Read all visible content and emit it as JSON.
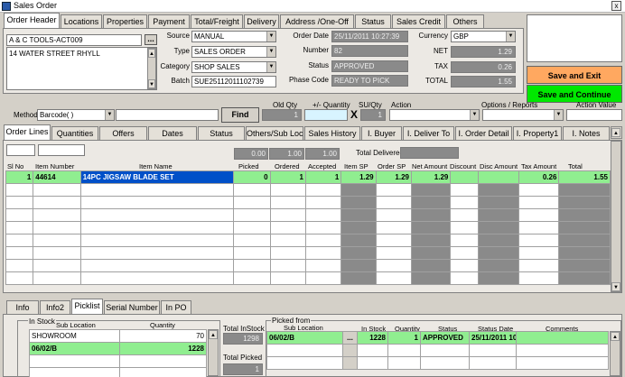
{
  "window": {
    "title": "Sales Order",
    "close": "x"
  },
  "top_tabs": [
    {
      "label": "Order Header",
      "active": true
    },
    {
      "label": "Locations"
    },
    {
      "label": "Properties"
    },
    {
      "label": "Payment"
    },
    {
      "label": "Total/Freight"
    },
    {
      "label": "Delivery"
    },
    {
      "label": "Address /One-Off"
    },
    {
      "label": "Status"
    },
    {
      "label": "Sales Credit"
    },
    {
      "label": "Others"
    }
  ],
  "header": {
    "customer_name": "A & C TOOLS-ACT009",
    "customer_address": "14 WATER STREET  RHYLL",
    "lookup_btn": "...",
    "source_label": "Source",
    "source": "MANUAL",
    "type_label": "Type",
    "type": "SALES ORDER",
    "category_label": "Category",
    "category": "SHOP SALES",
    "batch_label": "Batch",
    "batch": "SUE25112011102739",
    "order_date_label": "Order  Date",
    "order_date": "25/11/2011 10:27:39",
    "number_label": "Number",
    "number": "82",
    "status_label": "Status",
    "status": "APPROVED",
    "phase_label": "Phase Code",
    "phase": "READY TO PICK",
    "currency_label": "Currency",
    "currency": "GBP",
    "net_label": "NET",
    "net": "1.29",
    "tax_label": "TAX",
    "tax": "0.26",
    "total_label": "TOTAL",
    "total": "1.55"
  },
  "actions": {
    "save_exit": "Save and Exit",
    "save_continue": "Save and Continue"
  },
  "method_bar": {
    "method_label": "Method",
    "method": "Barcode( )",
    "find": "Find",
    "old_qty_label": "Old Qty",
    "old_qty": "1",
    "plus_minus_label": "+/- Quantity",
    "su_qty_label": "SU/Qty",
    "su_qty": "1",
    "x": "X",
    "action_label": "Action",
    "options_label": "Options / Reports",
    "action_value_label": "Action Value"
  },
  "line_tabs": [
    {
      "label": "Order Lines",
      "active": true
    },
    {
      "label": "Quantities"
    },
    {
      "label": "Offers"
    },
    {
      "label": "Dates"
    },
    {
      "label": "Status"
    },
    {
      "label": "Others/Sub Loc"
    },
    {
      "label": "Sales History"
    },
    {
      "label": "I. Buyer"
    },
    {
      "label": "I. Deliver To"
    },
    {
      "label": "I. Order Detail"
    },
    {
      "label": "I. Property1"
    },
    {
      "label": "I. Notes"
    }
  ],
  "totals_row": {
    "picked": "0.00",
    "ordered": "1.00",
    "accepted": "1.00",
    "delivered_label": "Total Delivered"
  },
  "lines": {
    "columns": [
      "Sl No",
      "Item Number",
      "Item Name",
      "Picked",
      "Ordered",
      "Accepted",
      "Item SP",
      "Order SP",
      "Net Amount",
      "Discount",
      "Disc Amount",
      "Tax Amount",
      "Total"
    ],
    "rows": [
      [
        "1",
        "44614",
        "14PC JIGSAW BLADE SET",
        "0",
        "1",
        "1",
        "1.29",
        "1.29",
        "1.29",
        "",
        "",
        "0.26",
        "1.55"
      ]
    ]
  },
  "bottom_tabs": [
    {
      "label": "Info"
    },
    {
      "label": "Info2"
    },
    {
      "label": "Picklist",
      "active": true
    },
    {
      "label": "Serial Number"
    },
    {
      "label": "In PO"
    }
  ],
  "instock": {
    "group_label": "In Stock",
    "columns": [
      "Sub Location",
      "Quantity"
    ],
    "rows": [
      [
        "SHOWROOM",
        "70"
      ],
      [
        "06/02/B",
        "1228"
      ]
    ],
    "total_instock_label": "Total InStock",
    "total_instock": "1298",
    "total_picked_label": "Total Picked",
    "total_picked": "1"
  },
  "picked_from": {
    "group_label": "Picked from",
    "columns": [
      "Sub Location",
      "In Stock",
      "Quantity",
      "Status",
      "Status Date",
      "Comments"
    ],
    "rows": [
      [
        "06/02/B",
        "1228",
        "1",
        "APPROVED",
        "25/11/2011 10:",
        ""
      ]
    ],
    "lookup_btn": "..."
  },
  "colors": {
    "green": "#90ee90",
    "orange": "#ffa860",
    "bright_green": "#00e800",
    "dark_field": "#8a8a8a",
    "highlight": "#0050c8"
  }
}
